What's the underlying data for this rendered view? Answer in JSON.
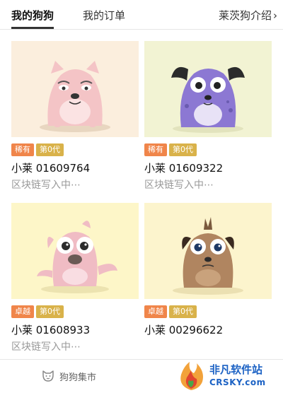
{
  "tabs": {
    "my_dogs": "我的狗狗",
    "my_orders": "我的订单",
    "intro": "莱茨狗介绍"
  },
  "dogs": [
    {
      "rarity": "稀有",
      "generation": "第0代",
      "name": "小莱 01609764",
      "status": "区块链写入中⋯",
      "bg": "#fbeedd",
      "body": "#f4c4c6"
    },
    {
      "rarity": "稀有",
      "generation": "第0代",
      "name": "小莱 01609322",
      "status": "区块链写入中⋯",
      "bg": "#f2f3d3",
      "body": "#8c78d3"
    },
    {
      "rarity": "卓越",
      "generation": "第0代",
      "name": "小莱 01608933",
      "status": "区块链写入中⋯",
      "bg": "#fdf6c8",
      "body": "#f0bcc4"
    },
    {
      "rarity": "卓越",
      "generation": "第0代",
      "name": "小莱 00296622",
      "status": "区块链写入中⋯",
      "bg": "#fcf4cd",
      "body": "#b08560"
    }
  ],
  "bottom_nav": {
    "market": "狗狗集市"
  },
  "watermark": {
    "title": "非凡软件站",
    "subtitle": "CRSKY.com"
  },
  "colors": {
    "rare_badge": "#f0854a",
    "generation_badge": "#d9b24a",
    "status_text": "#999999"
  }
}
